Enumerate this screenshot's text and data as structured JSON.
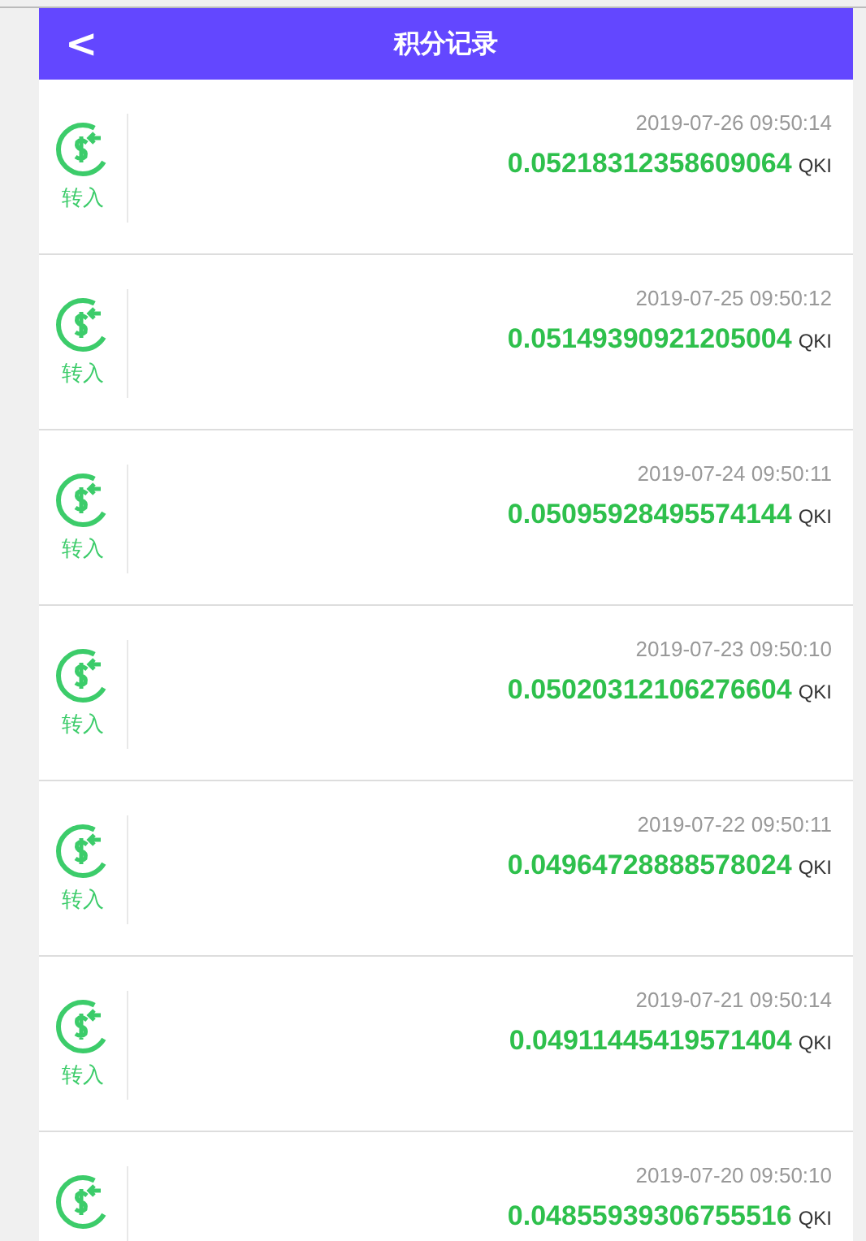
{
  "header": {
    "back": "<",
    "title": "积分记录"
  },
  "records": [
    {
      "kind": "in",
      "label": "转入",
      "time": "2019-07-26 09:50:14",
      "amount": "0.05218312358609064",
      "unit": "QKI"
    },
    {
      "kind": "in",
      "label": "转入",
      "time": "2019-07-25 09:50:12",
      "amount": "0.05149390921205004",
      "unit": "QKI"
    },
    {
      "kind": "in",
      "label": "转入",
      "time": "2019-07-24 09:50:11",
      "amount": "0.05095928495574144",
      "unit": "QKI"
    },
    {
      "kind": "in",
      "label": "转入",
      "time": "2019-07-23 09:50:10",
      "amount": "0.05020312106276604",
      "unit": "QKI"
    },
    {
      "kind": "in",
      "label": "转入",
      "time": "2019-07-22 09:50:11",
      "amount": "0.04964728888578024",
      "unit": "QKI"
    },
    {
      "kind": "in",
      "label": "转入",
      "time": "2019-07-21 09:50:14",
      "amount": "0.04911445419571404",
      "unit": "QKI"
    },
    {
      "kind": "in",
      "time": "2019-07-20 09:50:10",
      "amount": "0.04855939306755516",
      "unit": "QKI"
    }
  ]
}
